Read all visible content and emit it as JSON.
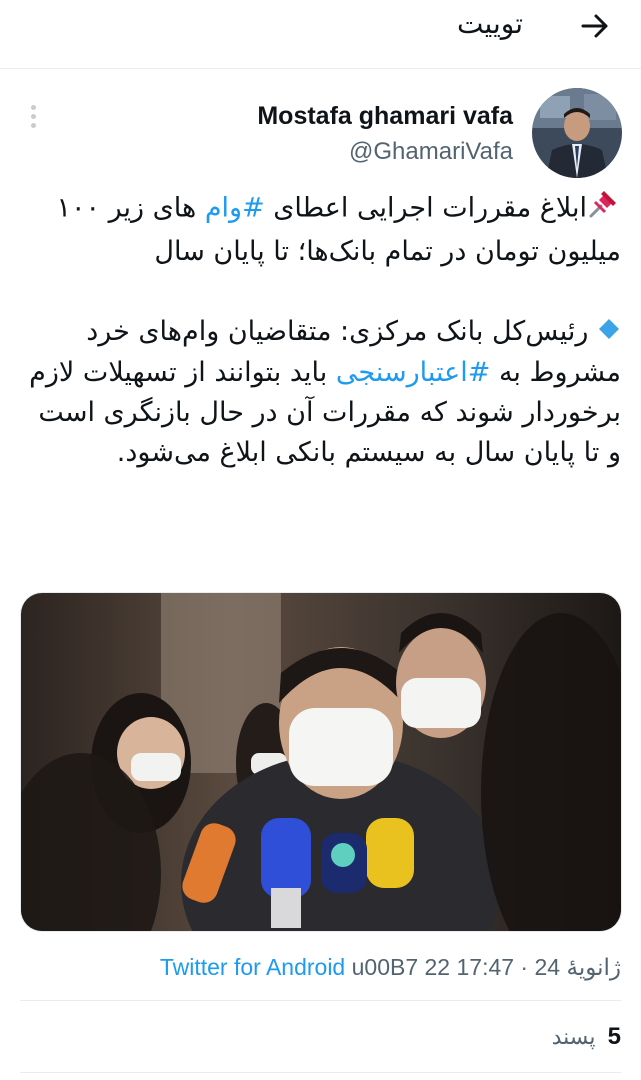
{
  "header": {
    "title": "توییت"
  },
  "tweet": {
    "author_name": "Mostafa ghamari vafa",
    "author_handle": "@GhamariVafa",
    "line1_pre": "ابلاغ مقررات اجرایی اعطای ",
    "line1_tag": "#وام",
    "line1_post": " های زیر ۱۰۰ میلیون تومان در تمام بانک‌ها؛ تا پایان سال",
    "para2_pre": "رئیس‌کل بانک مرکزی: متقاضیان وام‌های خرد مشروط به ",
    "para2_tag": "#اعتبارسنجی",
    "para2_post": " باید بتوانند از تسهیلات لازم برخوردار شوند که مقررات آن در حال بازنگری است و تا پایان سال به سیستم بانکی ابلاغ می‌شود."
  },
  "meta": {
    "source": "Twitter for Android",
    "date": "u00B7 22 ژانویهٔ 24",
    "time": "· 17:47"
  },
  "stats": {
    "likes_count": "5",
    "likes_label": "پسند"
  },
  "icons": {
    "back": "arrow-right-icon",
    "more": "more-vertical-icon",
    "pin": "pushpin-icon",
    "bullet": "blue-diamond-icon"
  },
  "colors": {
    "link": "#1d9bf0",
    "text": "#0f1419",
    "secondary": "#536471",
    "border": "#e6ecf0"
  }
}
